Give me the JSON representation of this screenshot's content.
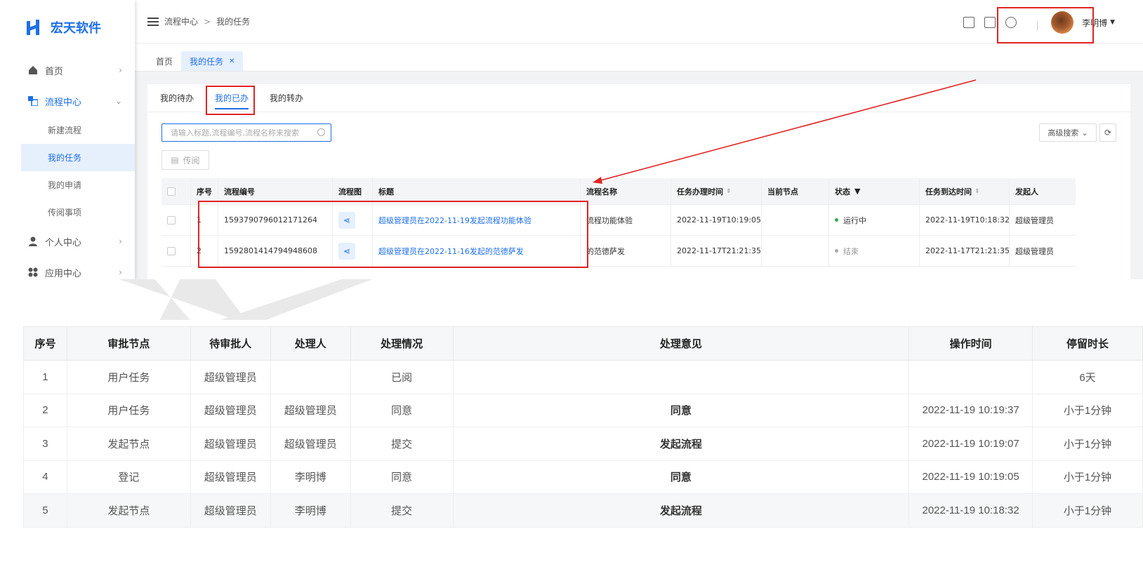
{
  "app": {
    "logo_text": "宏天软件"
  },
  "sidebar": {
    "items": [
      {
        "label": "首页",
        "icon": "home-icon"
      },
      {
        "label": "流程中心",
        "icon": "flow-center-icon"
      },
      {
        "label": "个人中心",
        "icon": "user-icon"
      },
      {
        "label": "应用中心",
        "icon": "apps-icon"
      }
    ],
    "sub_items": [
      "新建流程",
      "我的任务",
      "我的申请",
      "传阅事项"
    ]
  },
  "header": {
    "breadcrumb": [
      "流程中心",
      "我的任务"
    ],
    "username": "李明博"
  },
  "tabs": [
    "首页",
    "我的任务"
  ],
  "subtabs": [
    "我的待办",
    "我的已办",
    "我的转办"
  ],
  "search": {
    "placeholder": "请输入标题,流程编号,流程名称来搜索"
  },
  "toolbar": {
    "advanced_search": "高级搜索",
    "circulate": "传阅"
  },
  "task_table": {
    "headers": [
      "序号",
      "流程编号",
      "流程图",
      "标题",
      "流程名称",
      "任务办理时间",
      "当前节点",
      "状态",
      "任务到达时间",
      "发起人"
    ],
    "rows": [
      {
        "no": "1",
        "code": "1593790796012171264",
        "title": "超级管理员在2022-11-19发起流程功能体验",
        "flow_name": "流程功能体验",
        "handle_time": "2022-11-19T10:19:05",
        "node": "",
        "status": "运行中",
        "status_color": "#2fa84f",
        "arrive_time": "2022-11-19T10:18:32",
        "initiator": "超级管理员"
      },
      {
        "no": "2",
        "code": "1592801414794948608",
        "title": "超级管理员在2022-11-16发起的范德萨发",
        "flow_name": "的范德萨发",
        "handle_time": "2022-11-17T21:21:35",
        "node": "",
        "status": "结束",
        "status_color": "#aaaaaa",
        "arrive_time": "2022-11-17T21:21:35",
        "initiator": "超级管理员"
      }
    ]
  },
  "approval_table": {
    "headers": [
      "序号",
      "审批节点",
      "待审批人",
      "处理人",
      "处理情况",
      "处理意见",
      "操作时间",
      "停留时长"
    ],
    "rows": [
      {
        "no": "1",
        "node": "用户任务",
        "pending": "超级管理员",
        "handler": "",
        "status": "已阅",
        "opinion": "",
        "time": "",
        "duration": "6天"
      },
      {
        "no": "2",
        "node": "用户任务",
        "pending": "超级管理员",
        "handler": "超级管理员",
        "status": "同意",
        "opinion": "同意",
        "time": "2022-11-19 10:19:37",
        "duration": "小于1分钟"
      },
      {
        "no": "3",
        "node": "发起节点",
        "pending": "超级管理员",
        "handler": "超级管理员",
        "status": "提交",
        "opinion": "发起流程",
        "time": "2022-11-19 10:19:07",
        "duration": "小于1分钟"
      },
      {
        "no": "4",
        "node": "登记",
        "pending": "超级管理员",
        "handler": "李明博",
        "status": "同意",
        "opinion": "同意",
        "time": "2022-11-19 10:19:05",
        "duration": "小于1分钟"
      },
      {
        "no": "5",
        "node": "发起节点",
        "pending": "超级管理员",
        "handler": "李明博",
        "status": "提交",
        "opinion": "发起流程",
        "time": "2022-11-19 10:18:32",
        "duration": "小于1分钟"
      }
    ]
  },
  "colors": {
    "accent": "#1e6fe8",
    "highlight_box": "#e02424"
  }
}
